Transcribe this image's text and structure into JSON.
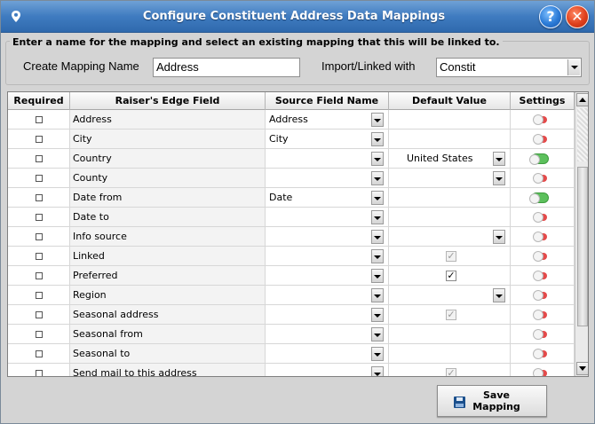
{
  "window": {
    "title": "Configure Constituent Address Data Mappings",
    "help_label": "?",
    "close_label": "✕",
    "icons": {
      "location": "location-pin-icon",
      "help": "help-icon",
      "close": "close-icon"
    }
  },
  "mapping": {
    "instruction": "Enter a name for the mapping and select an existing mapping that this will be linked to.",
    "create_label": "Create Mapping Name",
    "create_value": "Address",
    "linked_label": "Import/Linked with",
    "linked_value": "Constit"
  },
  "grid": {
    "columns": [
      "Required",
      "Raiser's Edge Field",
      "Source Field Name",
      "Default Value",
      "Settings"
    ],
    "rows": [
      {
        "field": "Address",
        "source": "Address",
        "default": "",
        "default_type": "none",
        "setting": "off"
      },
      {
        "field": "City",
        "source": "City",
        "default": "",
        "default_type": "none",
        "setting": "off"
      },
      {
        "field": "Country",
        "source": "",
        "default": "United States",
        "default_type": "dropdown",
        "setting": "on"
      },
      {
        "field": "County",
        "source": "",
        "default": "",
        "default_type": "dropdown",
        "setting": "off"
      },
      {
        "field": "Date from",
        "source": "Date",
        "default": "",
        "default_type": "none",
        "setting": "on"
      },
      {
        "field": "Date to",
        "source": "",
        "default": "",
        "default_type": "none",
        "setting": "off"
      },
      {
        "field": "Info source",
        "source": "",
        "default": "",
        "default_type": "dropdown",
        "setting": "off"
      },
      {
        "field": "Linked",
        "source": "",
        "default": "",
        "default_type": "checkbox-dim",
        "setting": "off"
      },
      {
        "field": "Preferred",
        "source": "",
        "default": "",
        "default_type": "checkbox",
        "setting": "off"
      },
      {
        "field": "Region",
        "source": "",
        "default": "",
        "default_type": "dropdown",
        "setting": "off"
      },
      {
        "field": "Seasonal address",
        "source": "",
        "default": "",
        "default_type": "checkbox-dim",
        "setting": "off"
      },
      {
        "field": "Seasonal from",
        "source": "",
        "default": "",
        "default_type": "none",
        "setting": "off"
      },
      {
        "field": "Seasonal to",
        "source": "",
        "default": "",
        "default_type": "none",
        "setting": "off"
      },
      {
        "field": "Send mail to this address",
        "source": "",
        "default": "",
        "default_type": "checkbox-dim",
        "setting": "off"
      }
    ]
  },
  "actions": {
    "save_line1": "Save",
    "save_line2": "Mapping",
    "save_icon": "floppy-disk-icon"
  },
  "colors": {
    "title_bar": "#3f7bc0",
    "toggle_off": "#e44a4a",
    "toggle_on": "#5cc05c"
  }
}
